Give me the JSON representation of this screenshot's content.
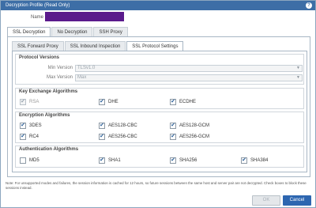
{
  "window": {
    "title": "Decryption Profile (Read Only)",
    "help_glyph": "?"
  },
  "name_field": {
    "label": "Name"
  },
  "outer_tabs": [
    {
      "label": "SSL Decryption",
      "active": true
    },
    {
      "label": "No Decryption",
      "active": false
    },
    {
      "label": "SSH Proxy",
      "active": false
    }
  ],
  "inner_tabs": [
    {
      "label": "SSL Forward Proxy",
      "active": false
    },
    {
      "label": "SSL Inbound Inspection",
      "active": false
    },
    {
      "label": "SSL Protocol Settings",
      "active": true
    }
  ],
  "protocol_versions": {
    "title": "Protocol Versions",
    "min_label": "Min Version",
    "min_value": "TLSv1.0",
    "max_label": "Max Version",
    "max_value": "Max"
  },
  "key_exchange": {
    "title": "Key Exchange Algorithms",
    "items": [
      {
        "label": "RSA",
        "checked": true,
        "disabled": true
      },
      {
        "label": "DHE",
        "checked": true,
        "disabled": false
      },
      {
        "label": "ECDHE",
        "checked": true,
        "disabled": false
      }
    ]
  },
  "encryption": {
    "title": "Encryption Algorithms",
    "items": [
      {
        "label": "3DES",
        "checked": true
      },
      {
        "label": "AES128-CBC",
        "checked": true
      },
      {
        "label": "AES128-GCM",
        "checked": true
      },
      {
        "label": "RC4",
        "checked": true
      },
      {
        "label": "AES256-CBC",
        "checked": true
      },
      {
        "label": "AES256-GCM",
        "checked": true
      }
    ]
  },
  "authentication": {
    "title": "Authentication Algorithms",
    "items": [
      {
        "label": "MD5",
        "checked": false
      },
      {
        "label": "SHA1",
        "checked": true
      },
      {
        "label": "SHA256",
        "checked": true
      },
      {
        "label": "SHA384",
        "checked": true
      }
    ]
  },
  "note": "Note: For unsupported modes and failures, the session information is cached for 12 hours, so future sessions between the same host and server pair are not decrypted. Check boxes to block these sessions instead.",
  "buttons": {
    "ok": "OK",
    "cancel": "Cancel"
  },
  "check_glyph": "✔",
  "dropdown_glyph": "▼"
}
